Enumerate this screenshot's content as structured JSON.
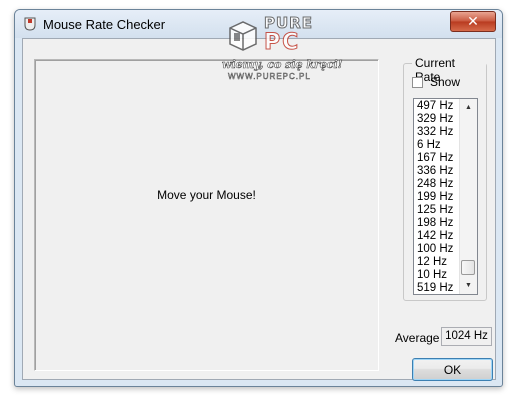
{
  "window": {
    "title": "Mouse Rate Checker",
    "close_glyph": "✕"
  },
  "canvas": {
    "message": "Move your Mouse!"
  },
  "current_rate": {
    "group_title": "Current Rate",
    "show_label": "Show",
    "show_checked": false,
    "items": [
      "497 Hz",
      "329 Hz",
      "332 Hz",
      "6 Hz",
      "167 Hz",
      "336 Hz",
      "248 Hz",
      "199 Hz",
      "125 Hz",
      "198 Hz",
      "142 Hz",
      "100 Hz",
      "12 Hz",
      "10 Hz",
      "519 Hz"
    ]
  },
  "average": {
    "label": "Average",
    "value": "1024 Hz"
  },
  "buttons": {
    "ok_label": "OK"
  },
  "watermark": {
    "brand_top": "PURE",
    "brand_bottom": "PC",
    "slogan": "wiemy, co się kręci!",
    "url": "WWW.PUREPC.PL"
  },
  "icons": {
    "app": "mouse-app-icon",
    "close": "close-icon",
    "scroll_up": "scroll-up-arrow-icon",
    "scroll_down": "scroll-down-arrow-icon"
  }
}
